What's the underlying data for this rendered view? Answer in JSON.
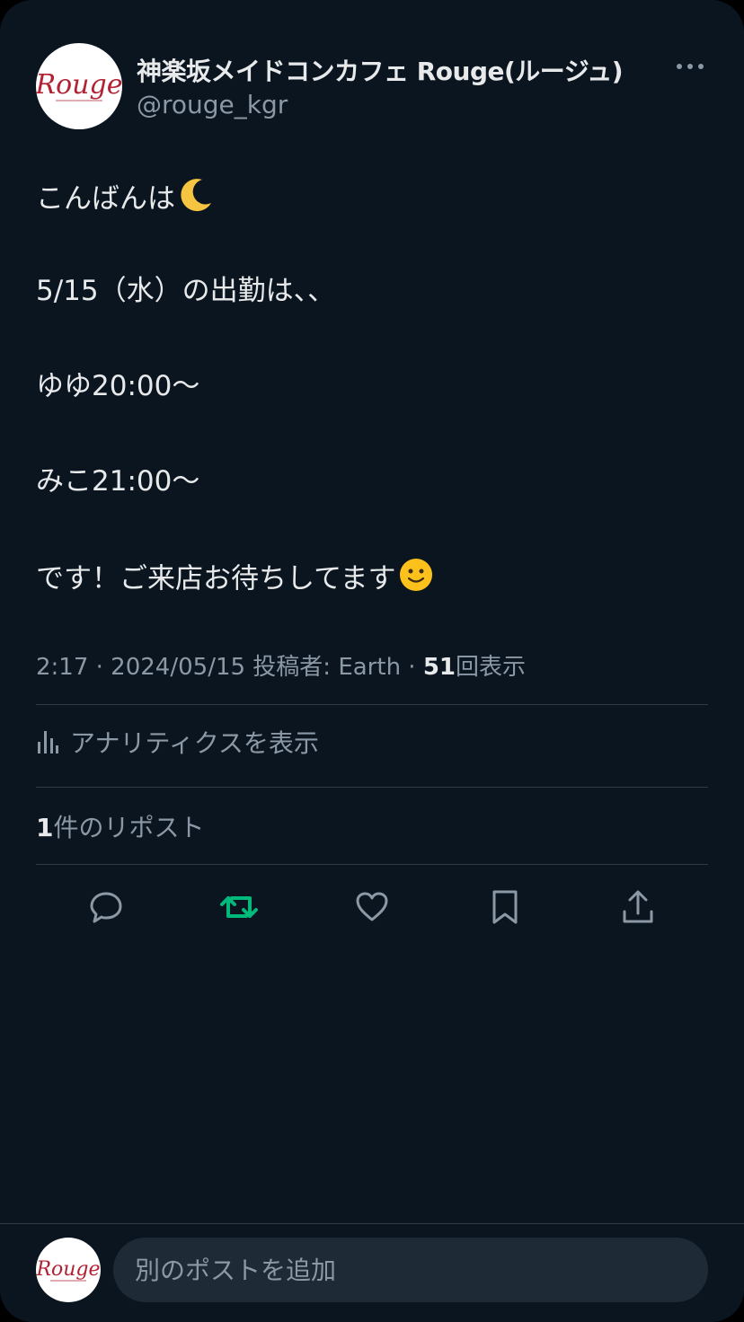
{
  "post": {
    "display_name": "神楽坂メイドコンカフェ Rouge(ルージュ)",
    "handle": "@rouge_kgr",
    "avatar_logo_text": "Rouge",
    "more_icon": "more-icon",
    "lines": {
      "l1": "こんばんは",
      "l2": "5/15（水）の出勤は、、",
      "l3": "ゆゆ20:00〜",
      "l4": "みこ21:00〜",
      "l5": "です！ご来店お待ちしてます"
    },
    "emoji": {
      "moon": "crescent-moon",
      "smile": "slightly-smiling-face"
    },
    "meta": {
      "prefix": "2:17 · 2024/05/15 投稿者: Earth · ",
      "views_count": "51",
      "views_label": "回表示"
    },
    "analytics_label": "アナリティクスを表示",
    "reposts": {
      "count": "1",
      "label": "件のリポスト"
    }
  },
  "actions": [
    "reply-icon",
    "repost-icon",
    "like-icon",
    "bookmark-icon",
    "share-icon"
  ],
  "reply": {
    "placeholder": "別のポストを追加"
  },
  "colors": {
    "background": "#0b1520",
    "text": "#e7e9ea",
    "secondary_text": "#8b98a5",
    "repost_active": "#00ba7c",
    "logo_red": "#b22234",
    "input_bg": "#1e2a36"
  }
}
